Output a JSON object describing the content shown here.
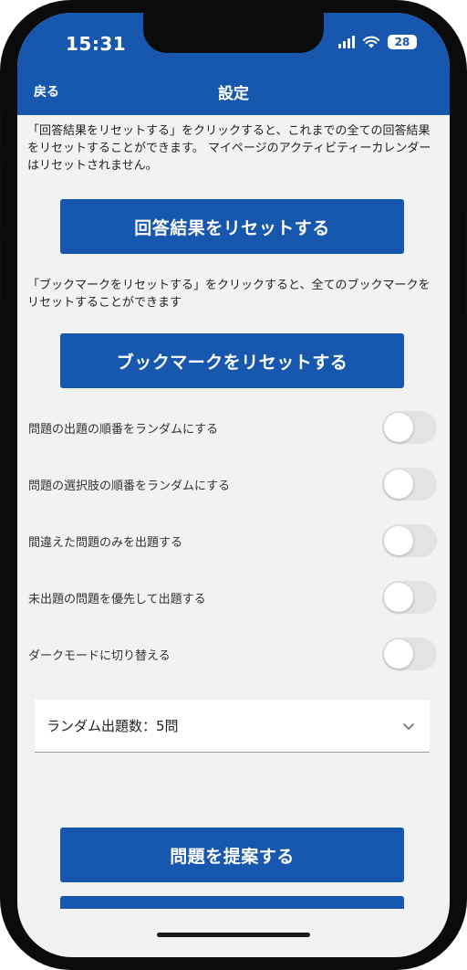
{
  "status_bar": {
    "time": "15:31",
    "battery": "28"
  },
  "header": {
    "back_label": "戻る",
    "title": "設定"
  },
  "reset_answers": {
    "description": "「回答結果をリセットする」をクリックすると、これまでの全ての回答結果をリセットすることができます。 マイページのアクティビティーカレンダーはリセットされません。",
    "button_label": "回答結果をリセットする"
  },
  "reset_bookmarks": {
    "description": "「ブックマークをリセットする」をクリックすると、全てのブックマークをリセットすることができます",
    "button_label": "ブックマークをリセットする"
  },
  "toggles": [
    {
      "label": "問題の出題の順番をランダムにする",
      "on": false
    },
    {
      "label": "問題の選択肢の順番をランダムにする",
      "on": false
    },
    {
      "label": "間違えた問題のみを出題する",
      "on": false
    },
    {
      "label": "未出題の問題を優先して出題する",
      "on": false
    },
    {
      "label": "ダークモードに切り替える",
      "on": false
    }
  ],
  "random_count_select": {
    "value": "ランダム出題数：5問"
  },
  "propose_button": {
    "label": "問題を提案する"
  },
  "icons": {
    "back": "",
    "select": "chevron-down-icon",
    "wifi": "wifi-icon",
    "signal": "signal-icon",
    "battery": "battery-icon"
  },
  "colors": {
    "primary": "#1758ae",
    "background": "#f2f2f2",
    "toggle_off": "#e3e3e3"
  }
}
